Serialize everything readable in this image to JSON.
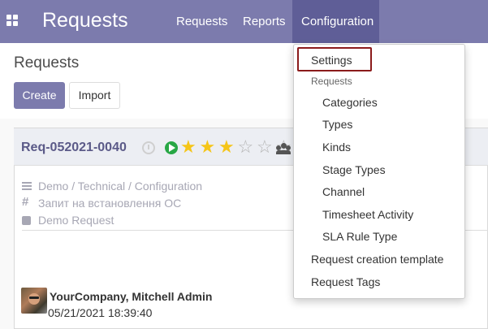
{
  "navbar": {
    "app_title": "Requests",
    "menu": {
      "requests": "Requests",
      "reports": "Reports",
      "configuration": "Configuration"
    }
  },
  "control_panel": {
    "title": "Requests",
    "create_label": "Create",
    "import_label": "Import"
  },
  "request": {
    "name": "Req-052021-0040",
    "rating": 3,
    "rating_max": 6,
    "category_path": "Demo / Technical / Configuration",
    "subject": "Запит на встановлення ОС",
    "type": "Demo Request",
    "author": "YourCompany, Mitchell Admin",
    "date": "05/21/2021 18:39:40",
    "colors": {
      "star_on": "#f5c518",
      "star_off": "#b5b5b5",
      "stage": "#28a745"
    }
  },
  "dropdown": {
    "settings": "Settings",
    "section_header": "Requests",
    "items": [
      "Categories",
      "Types",
      "Kinds",
      "Stage Types",
      "Channel",
      "Timesheet Activity",
      "SLA Rule Type"
    ],
    "request_creation_template": "Request creation template",
    "request_tags": "Request Tags"
  },
  "theme": {
    "brand": "#7c7bad",
    "active_menu": "#5f5e97",
    "highlight_border": "#8b1b1b"
  }
}
